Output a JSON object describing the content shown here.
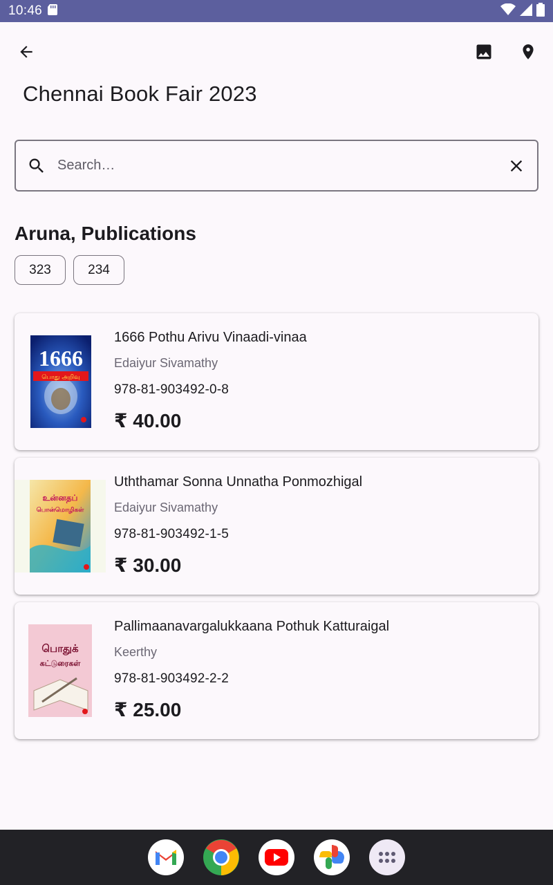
{
  "status_bar": {
    "time": "10:46"
  },
  "app_bar": {
    "title": "Chennai Book Fair 2023",
    "icons": [
      "back-arrow-icon",
      "image-icon",
      "location-pin-icon"
    ]
  },
  "search": {
    "placeholder": "Search…",
    "value": ""
  },
  "publisher": {
    "name": "Aruna, Publications",
    "stalls": [
      "323",
      "234"
    ]
  },
  "books": [
    {
      "title": "1666 Pothu Arivu Vinaadi-vinaa",
      "author": "Edaiyur Sivamathy",
      "isbn": "978-81-903492-0-8",
      "price": "₹ 40.00",
      "cover_text": "1666",
      "cover_subtext": "பொது அறிவு"
    },
    {
      "title": "Uththamar Sonna Unnatha Ponmozhigal",
      "author": "Edaiyur Sivamathy",
      "isbn": "978-81-903492-1-5",
      "price": "₹ 30.00",
      "cover_text": "உன்னதப்",
      "cover_subtext": "பொன்மொழிகள்"
    },
    {
      "title": "Pallimaanavargalukkaana Pothuk Katturaigal",
      "author": "Keerthy",
      "isbn": "978-81-903492-2-2",
      "price": "₹ 25.00",
      "cover_text": "பொதுக்",
      "cover_subtext": "கட்டுரைகள்"
    }
  ],
  "dock": {
    "apps": [
      "gmail-icon",
      "chrome-icon",
      "youtube-icon",
      "photos-icon",
      "app-drawer-icon"
    ]
  },
  "colors": {
    "status_bar": "#5c5f9e",
    "background": "#fcf8fc",
    "nav_bar": "#222226"
  }
}
